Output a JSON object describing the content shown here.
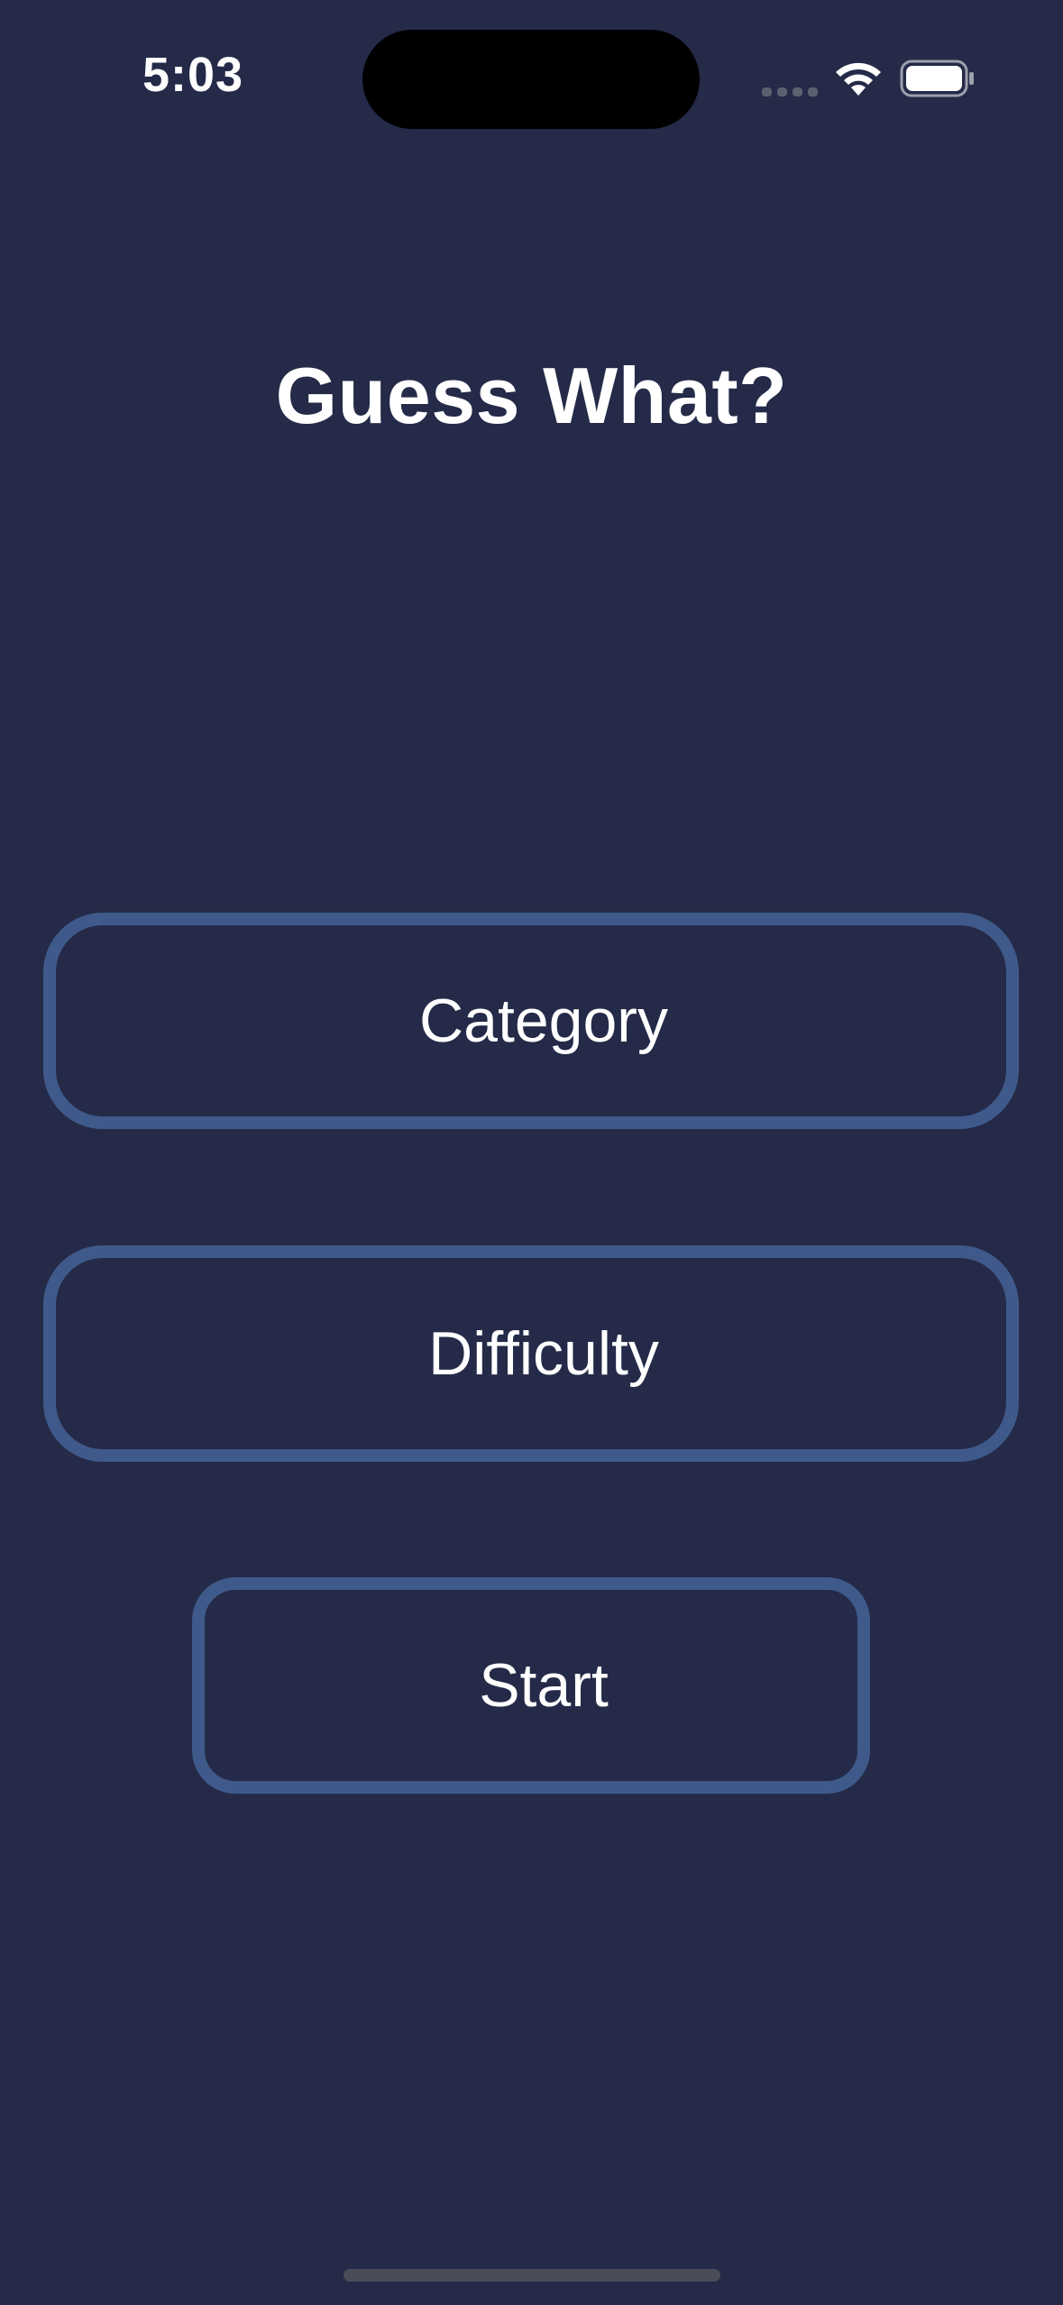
{
  "status_bar": {
    "time": "5:03",
    "icons": [
      "signal-icon",
      "wifi-icon",
      "battery-icon"
    ]
  },
  "app": {
    "title": "Guess What?"
  },
  "menu": {
    "category_label": "Category",
    "difficulty_label": "Difficulty",
    "start_label": "Start"
  },
  "colors": {
    "background": "#242A48",
    "button_border": "#3F5A8A",
    "text": "#FFFFFF"
  }
}
